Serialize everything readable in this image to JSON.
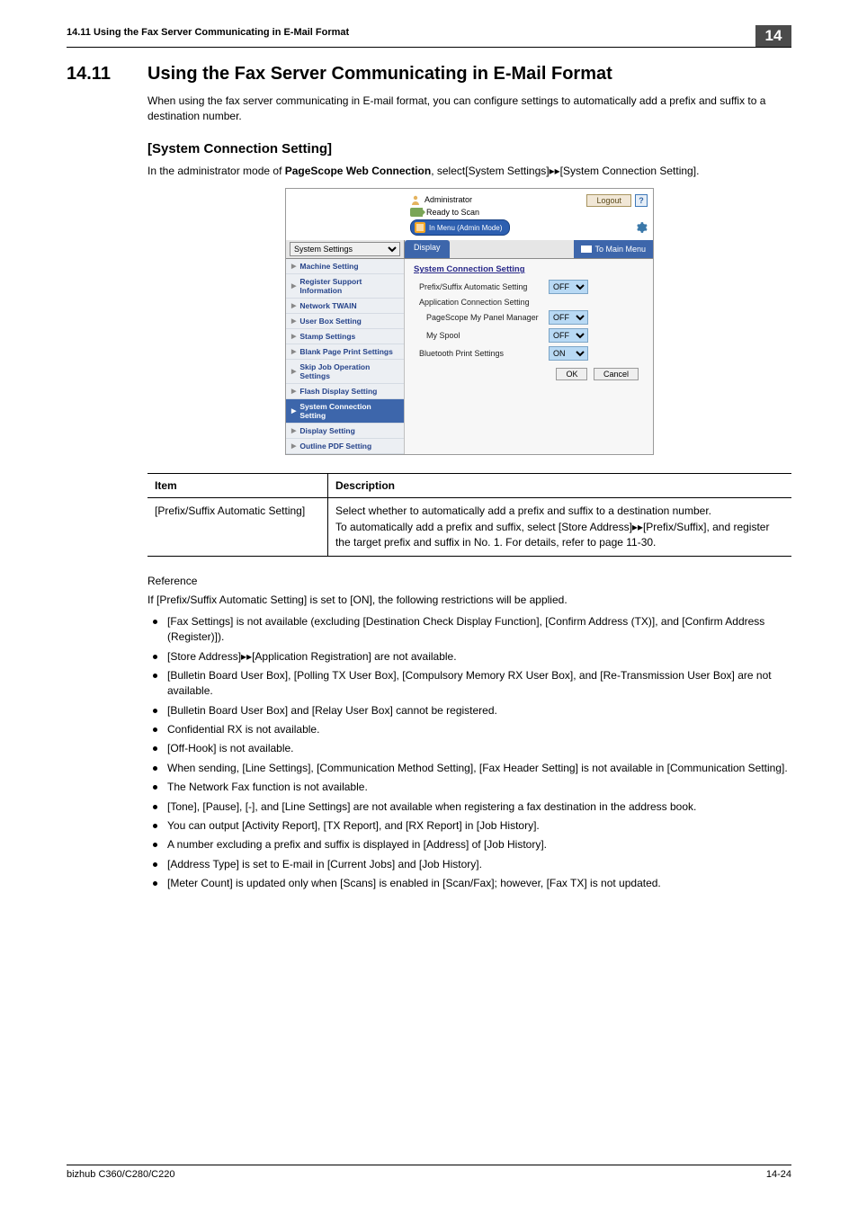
{
  "pageHeader": {
    "left": "14.11   Using the Fax Server Communicating in E-Mail Format",
    "chapter": "14"
  },
  "heading1": {
    "num": "14.11",
    "text": "Using the Fax Server Communicating in E-Mail Format"
  },
  "p1": "When using the fax server communicating in E-mail format, you can configure settings to automatically add a prefix and suffix to a destination number.",
  "h2": "[System Connection Setting]",
  "h2_under_pre": "In the administrator mode of ",
  "h2_under_bold": "PageScope Web Connection",
  "h2_under_post": ", select[System Settings]▸▸[System Connection Setting].",
  "shot": {
    "adminLabel": "Administrator",
    "ready": "Ready to Scan",
    "modePill": "In Menu (Admin Mode)",
    "logout": "Logout",
    "help": "?",
    "sideSelect": "System Settings",
    "tabActive": "Display",
    "toMain": "To Main Menu",
    "side": {
      "items": [
        "Machine Setting",
        "Register Support Information",
        "Network TWAIN",
        "User Box Setting",
        "Stamp Settings",
        "Blank Page Print Settings",
        "Skip Job Operation Settings",
        "Flash Display Setting",
        "System Connection Setting",
        "Display Setting",
        "Outline PDF Setting"
      ],
      "activeIndex": 8
    },
    "mainTitle": "System Connection Setting",
    "rows": [
      {
        "label": "Prefix/Suffix Automatic Setting",
        "val": "OFF",
        "sel": true
      },
      {
        "label": "Application Connection Setting",
        "val": "",
        "sel": false
      },
      {
        "label": "PageScope My Panel Manager",
        "val": "OFF",
        "sel": true,
        "indent": true
      },
      {
        "label": "My Spool",
        "val": "OFF",
        "sel": true,
        "indent": true
      },
      {
        "label": "Bluetooth Print Settings",
        "val": "ON",
        "sel": true
      }
    ],
    "ok": "OK",
    "cancel": "Cancel"
  },
  "table": {
    "hdItem": "Item",
    "hdDesc": "Description",
    "rItem": "[Prefix/Suffix Automatic Setting]",
    "rDesc": "Select whether to automatically add a prefix and suffix to a destination number.\nTo automatically add a prefix and suffix, select [Store Address]▸▸[Prefix/Suffix], and register the target prefix and suffix in No. 1. For details, refer to page 11-30."
  },
  "reference": {
    "title": "Reference",
    "lead": "If [Prefix/Suffix Automatic Setting] is set to [ON], the following restrictions will be applied.",
    "items": [
      "[Fax Settings] is not available (excluding [Destination Check Display Function], [Confirm Address (TX)], and [Confirm Address (Register)]).",
      "[Store Address]▸▸[Application Registration] are not available.",
      "[Bulletin Board User Box], [Polling TX User Box], [Compulsory Memory RX User Box], and [Re-Transmission User Box] are not available.",
      "[Bulletin Board User Box] and [Relay User Box] cannot be registered.",
      "Confidential RX is not available.",
      "[Off-Hook] is not available.",
      "When sending, [Line Settings], [Communication Method Setting], [Fax Header Setting] is not available in [Communication Setting].",
      "The Network Fax function is not available.",
      "[Tone], [Pause], [-], and [Line Settings] are not available when registering a fax destination in the address book.",
      "You can output [Activity Report], [TX Report], and [RX Report] in [Job History].",
      "A number excluding a prefix and suffix is displayed in [Address] of [Job History].",
      "[Address Type] is set to E-mail in [Current Jobs] and [Job History].",
      "[Meter Count] is updated only when [Scans] is enabled in [Scan/Fax]; however, [Fax TX] is not updated."
    ]
  },
  "footer": {
    "left": "bizhub C360/C280/C220",
    "right": "14-24"
  }
}
